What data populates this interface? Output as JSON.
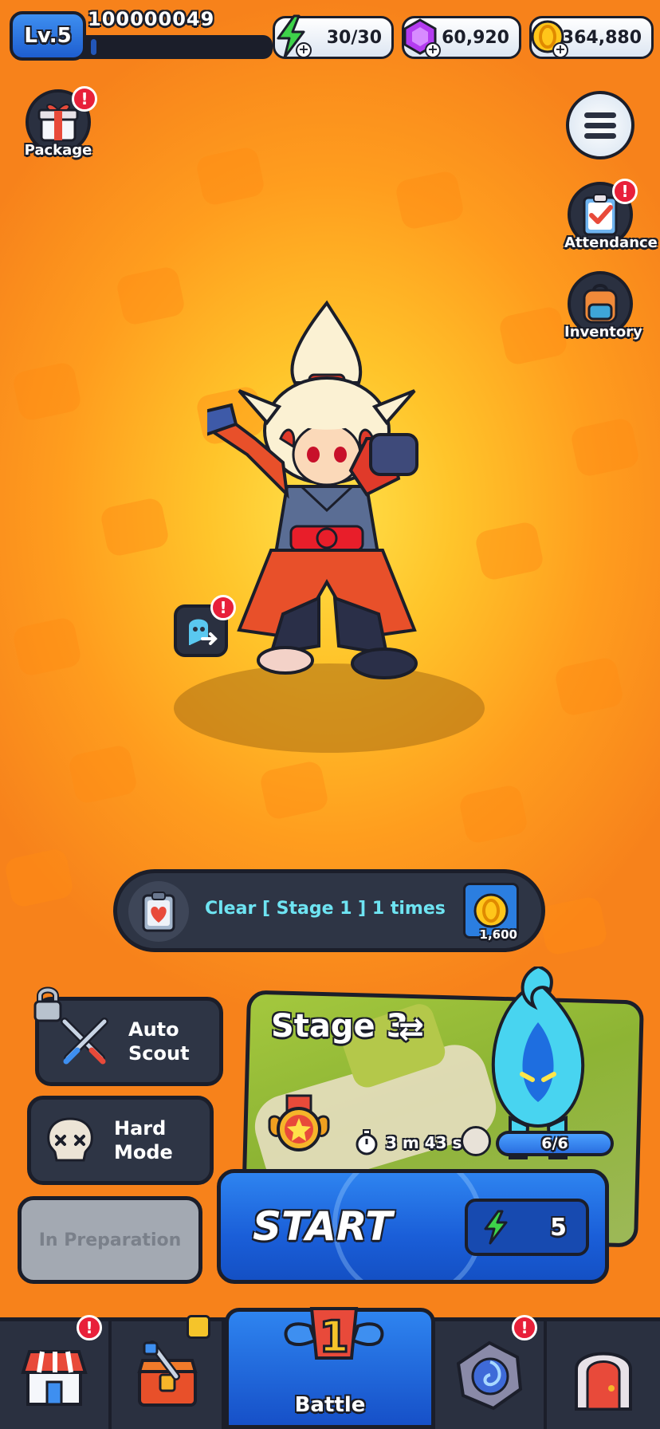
{
  "player": {
    "level": "Lv.5",
    "id": "100000049",
    "xp_fraction": 0.03
  },
  "resources": [
    {
      "icon": "energy-bolt-icon",
      "value": "30/30"
    },
    {
      "icon": "purple-gem-icon",
      "value": "60,920"
    },
    {
      "icon": "gold-coin-icon",
      "value": "364,880"
    }
  ],
  "side_buttons": {
    "package": "Package",
    "attendance": "Attendance",
    "inventory": "Inventory"
  },
  "alert_glyph": "!",
  "mission": {
    "text": "Clear [ Stage 1 ] 1 times",
    "reward_amount": "1,600"
  },
  "modes": {
    "auto_scout": "Auto\nScout",
    "hard_mode": "Hard\nMode",
    "in_preparation": "In Preparation"
  },
  "stage": {
    "name": "Stage 3",
    "swap_glyph": "⇄",
    "time": "3 m 43 s",
    "enemy_count": "6/6"
  },
  "start": {
    "label": "START",
    "energy_cost": "5"
  },
  "nav": {
    "battle": "Battle",
    "battle_rank": "1"
  },
  "colors": {
    "background": "#f7821b",
    "accent_blue": "#1a5ed8",
    "alert_red": "#e8203a",
    "mission_text": "#6ee4f2"
  }
}
